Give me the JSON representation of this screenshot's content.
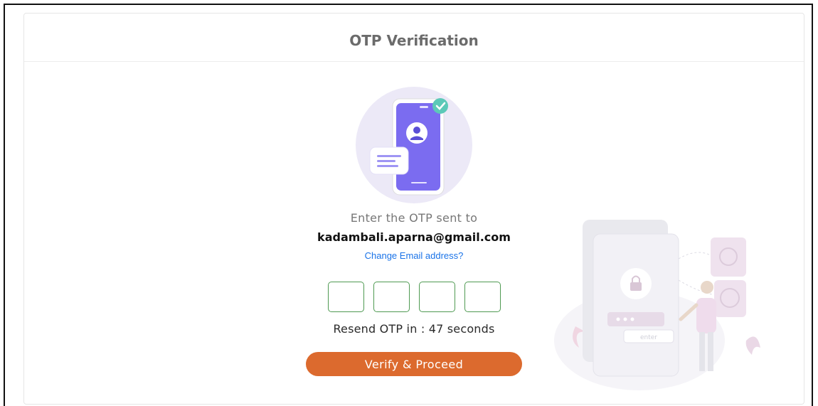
{
  "header": {
    "title": "OTP Verification"
  },
  "prompt": {
    "instruction": "Enter the OTP sent to",
    "email": "kadambali.aparna@gmail.com",
    "change_link": "Change Email address?"
  },
  "otp": {
    "digits": [
      "",
      "",
      "",
      ""
    ]
  },
  "resend": {
    "text": "Resend OTP in : 47 seconds"
  },
  "actions": {
    "verify_label": "Verify & Proceed"
  },
  "illustration": {
    "side_label": "enter"
  },
  "colors": {
    "accent": "#dc6a2e",
    "otp_border": "#4f9a52",
    "link": "#1a73e8",
    "phone": "#7b6cf0",
    "check": "#5cc9b8"
  }
}
